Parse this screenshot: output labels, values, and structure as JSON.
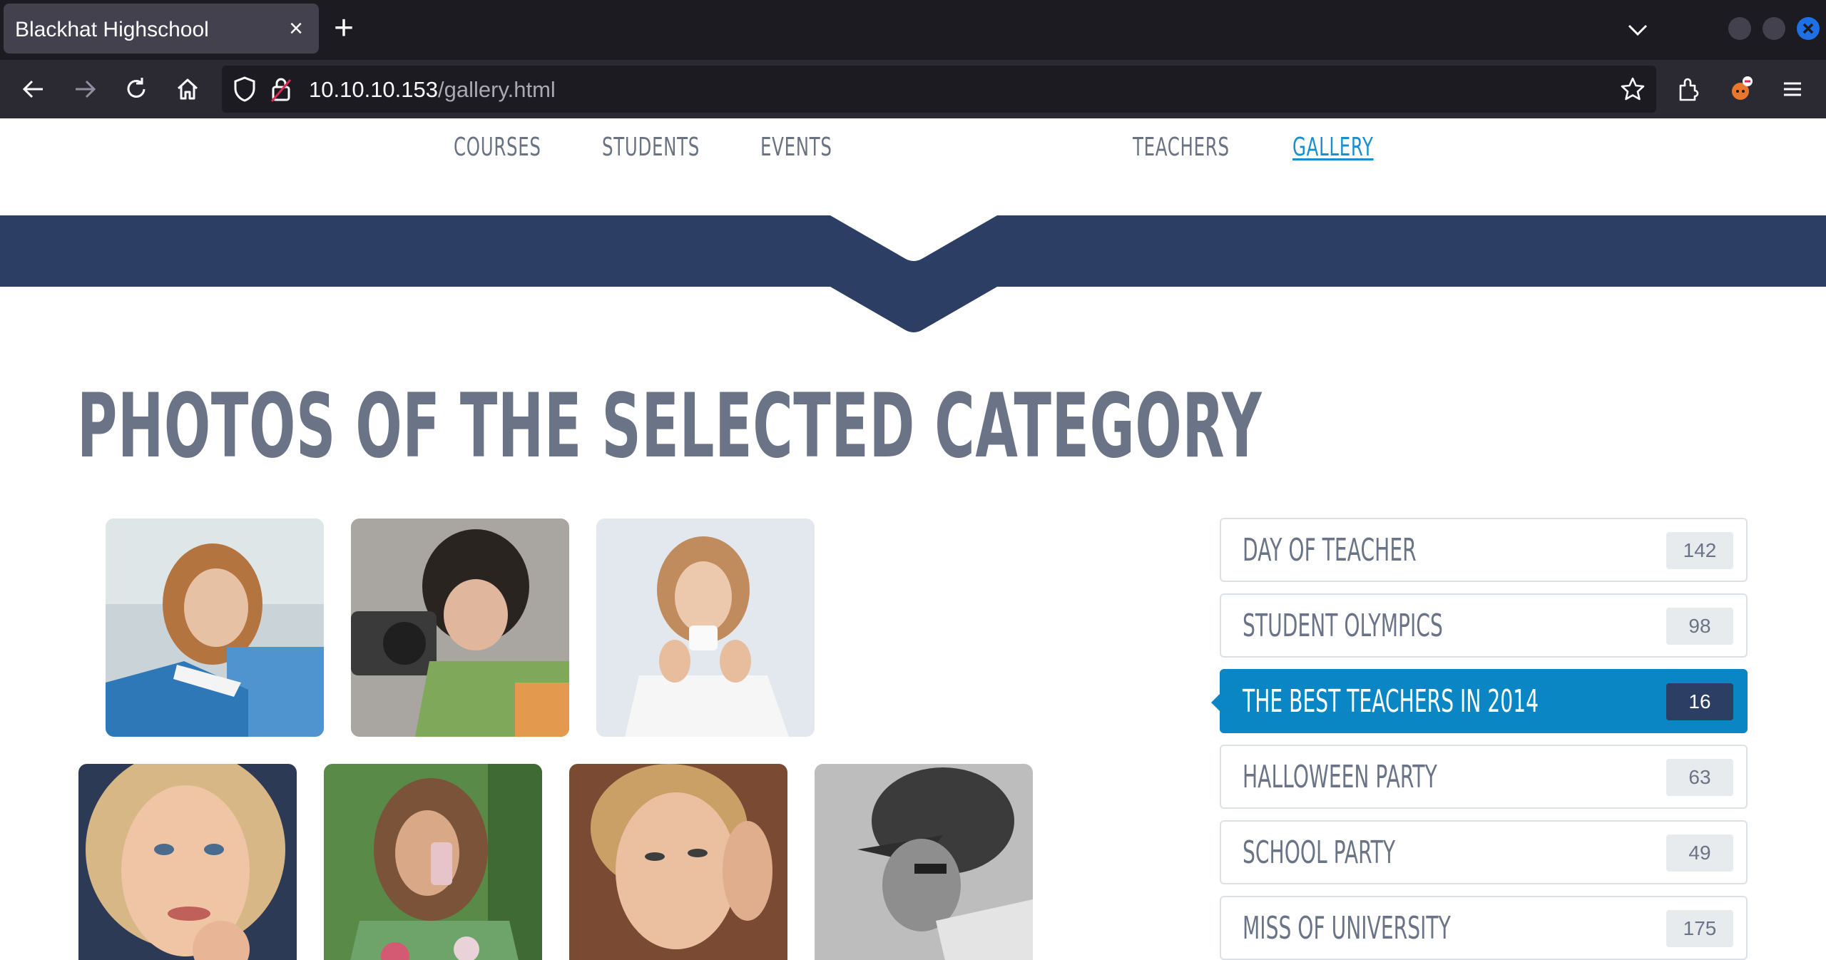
{
  "browser": {
    "tab_title": "Blackhat Highschool",
    "tab_close": "×",
    "new_tab": "+",
    "url_host": "10.10.10.153",
    "url_path": "/gallery.html"
  },
  "site_nav": {
    "items": [
      {
        "label": "COURSES"
      },
      {
        "label": "STUDENTS"
      },
      {
        "label": "EVENTS"
      },
      {
        "label": "TEACHERS"
      },
      {
        "label": "GALLERY",
        "active": true
      }
    ]
  },
  "main": {
    "section_title": "PHOTOS OF THE SELECTED CATEGORY"
  },
  "categories": [
    {
      "label": "DAY OF TEACHER",
      "count": "142"
    },
    {
      "label": "STUDENT OLYMPICS",
      "count": "98"
    },
    {
      "label": "THE BEST TEACHERS IN 2014",
      "count": "16",
      "active": true
    },
    {
      "label": "HALLOWEEN PARTY",
      "count": "63"
    },
    {
      "label": "SCHOOL PARTY",
      "count": "49"
    },
    {
      "label": "MISS OF UNIVERSITY",
      "count": "175"
    }
  ],
  "colors": {
    "band": "#2c3e63",
    "accent": "#0a86c4",
    "nav_active": "#1a8fd0",
    "heading": "#6b7487"
  }
}
